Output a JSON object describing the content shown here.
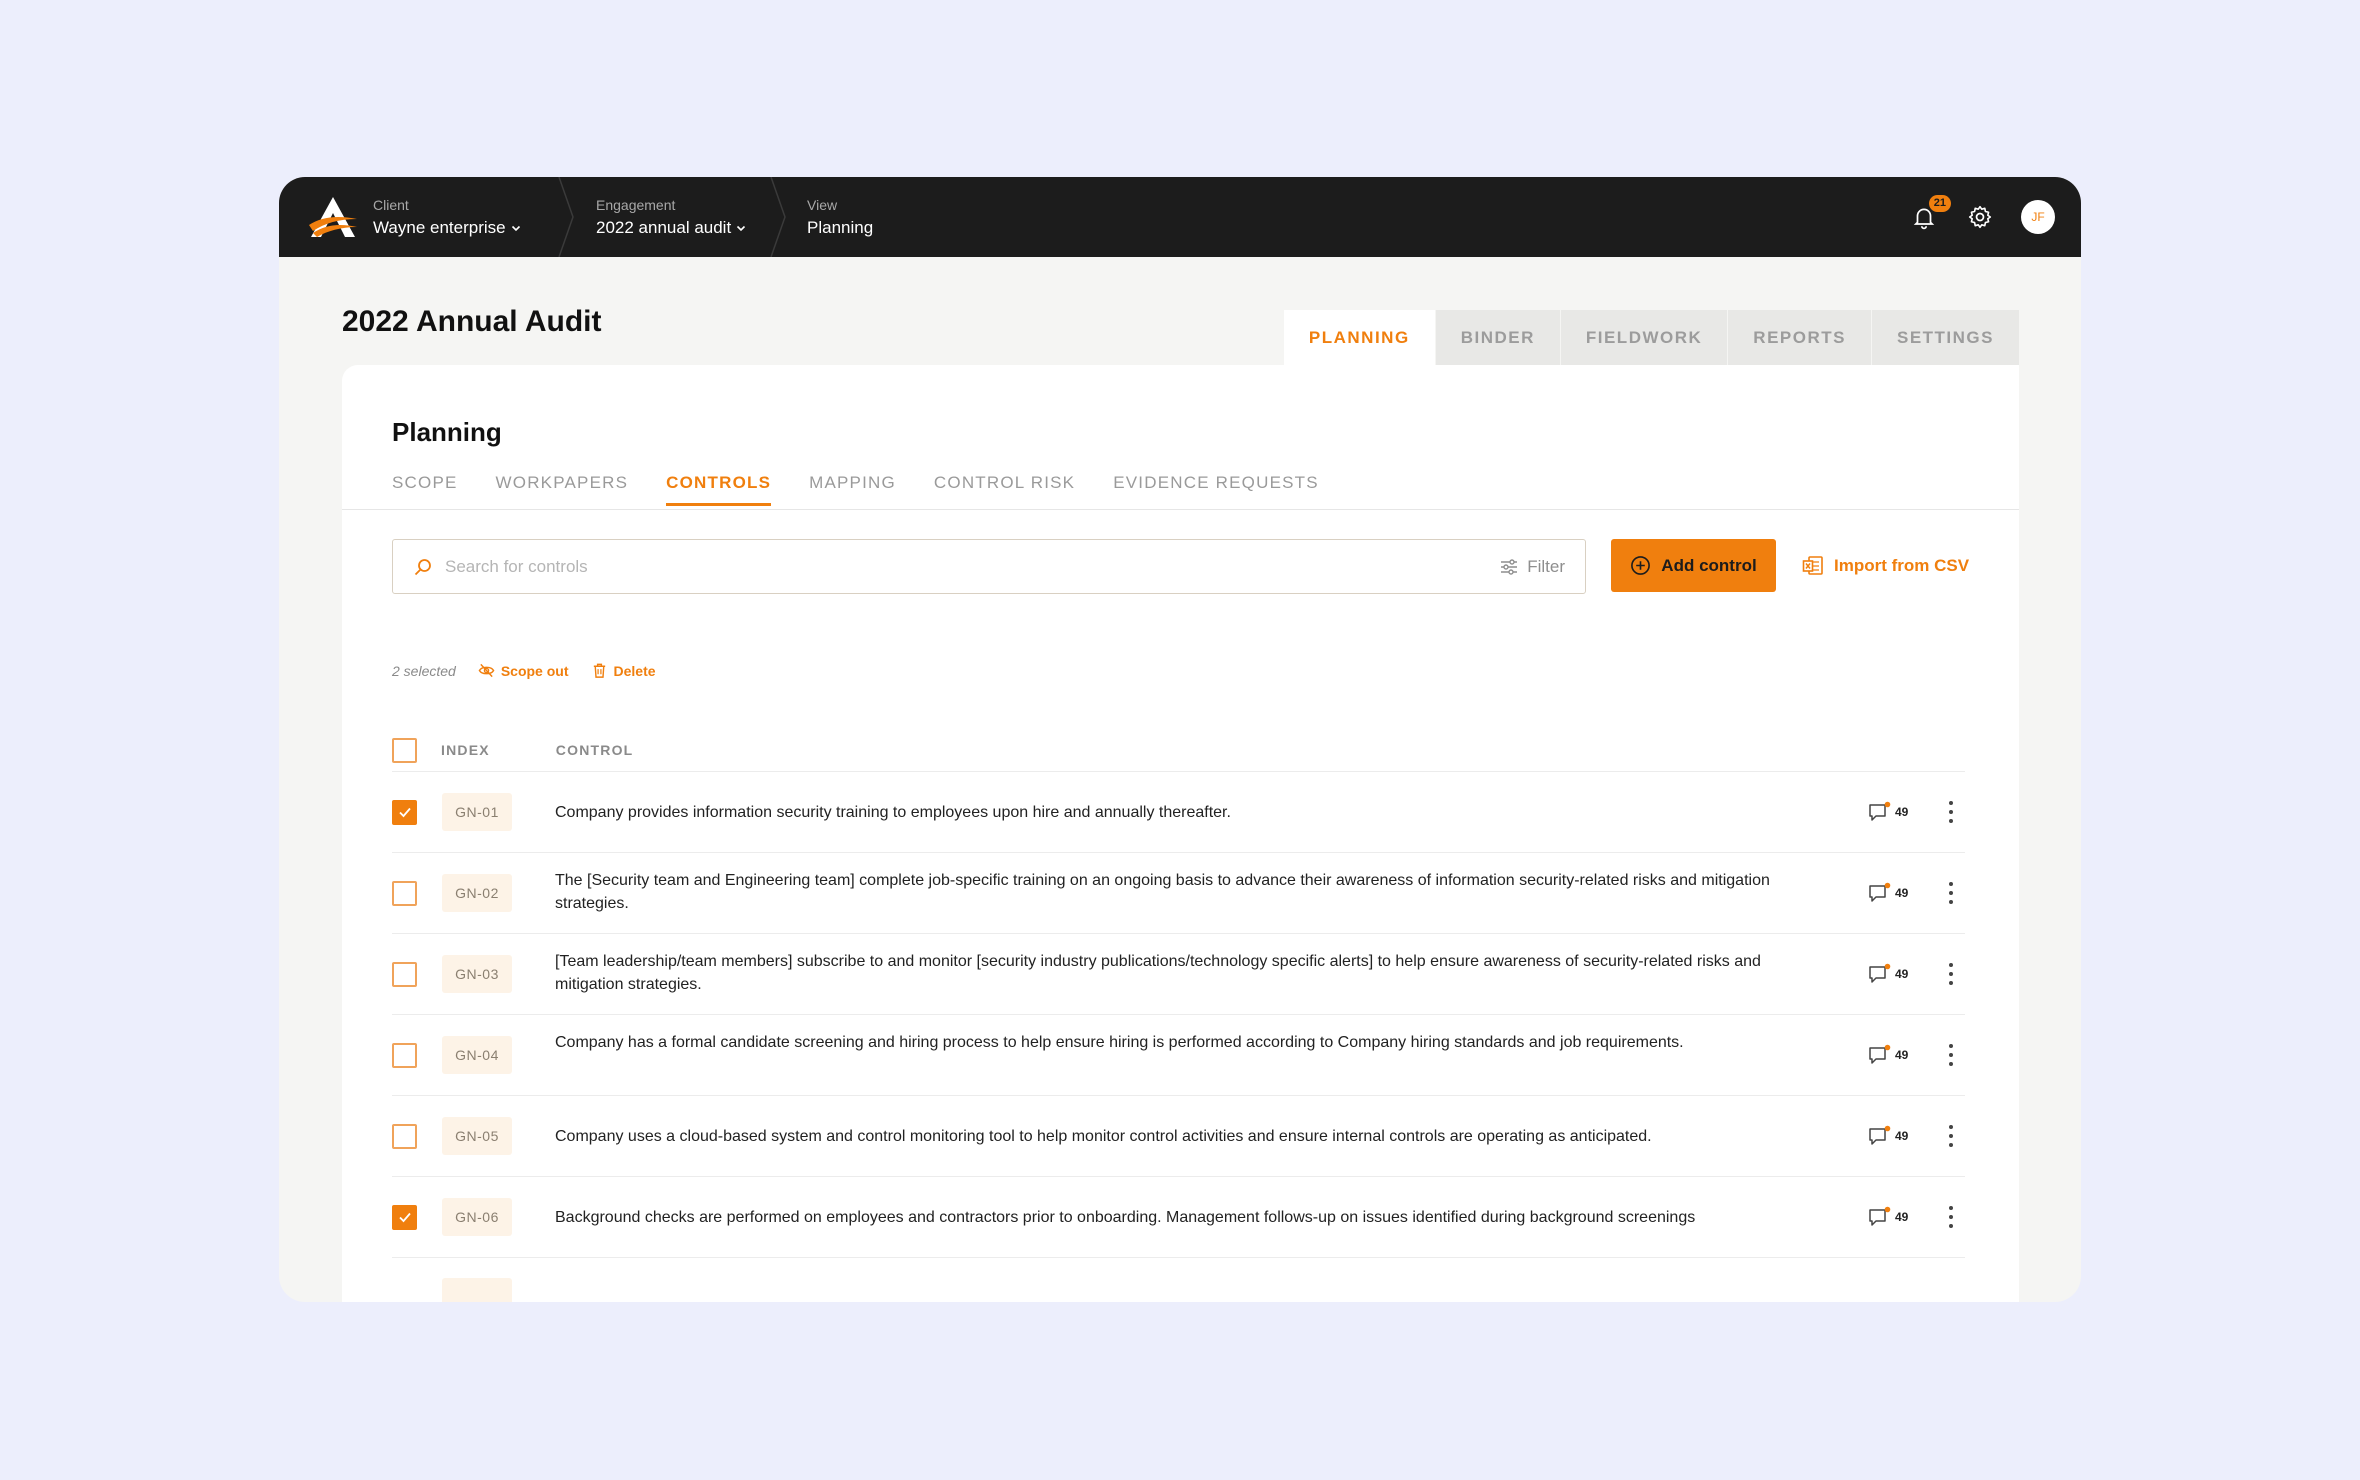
{
  "breadcrumbs": [
    {
      "label": "Client",
      "value": "Wayne enterprise"
    },
    {
      "label": "Engagement",
      "value": "2022 annual audit"
    },
    {
      "label": "View",
      "value": "Planning"
    }
  ],
  "topbar": {
    "notification_count": "21",
    "avatar_initials": "JF"
  },
  "page_title": "2022 Annual Audit",
  "main_tabs": [
    "PLANNING",
    "BINDER",
    "FIELDWORK",
    "REPORTS",
    "SETTINGS"
  ],
  "section_title": "Planning",
  "sub_tabs": [
    "SCOPE",
    "WORKPAPERS",
    "CONTROLS",
    "MAPPING",
    "CONTROL RISK",
    "EVIDENCE REQUESTS"
  ],
  "search": {
    "placeholder": "Search for controls",
    "filter_label": "Filter"
  },
  "actions": {
    "add_control": "Add control",
    "import_csv": "Import from CSV"
  },
  "selection": {
    "count_label": "2 selected",
    "scope_out": "Scope out",
    "delete": "Delete"
  },
  "table": {
    "headers": {
      "index": "INDEX",
      "control": "CONTROL"
    },
    "rows": [
      {
        "index": "GN-01",
        "checked": true,
        "comments": "49",
        "control": "Company provides information security training to employees upon hire and annually thereafter."
      },
      {
        "index": "GN-02",
        "checked": false,
        "comments": "49",
        "control": "The [Security team and Engineering team] complete job-specific training on an ongoing basis to advance their awareness of information security-related risks and mitigation strategies."
      },
      {
        "index": "GN-03",
        "checked": false,
        "comments": "49",
        "control": "[Team leadership/team members] subscribe to and monitor [security industry publications/technology specific alerts] to help ensure awareness of security-related risks and mitigation strategies."
      },
      {
        "index": "GN-04",
        "checked": false,
        "comments": "49",
        "control": "Company has a formal candidate screening and hiring process to help ensure hiring is performed according to Company hiring standards and job requirements."
      },
      {
        "index": "GN-05",
        "checked": false,
        "comments": "49",
        "control": "Company uses a cloud-based system and control monitoring tool to help monitor control activities and ensure internal controls are operating as anticipated."
      },
      {
        "index": "GN-06",
        "checked": true,
        "comments": "49",
        "control": "Background checks are performed on employees and contractors prior to onboarding. Management follows-up on issues identified during background screenings"
      }
    ]
  },
  "colors": {
    "accent": "#f07f0e",
    "topbar": "#1c1c1c",
    "background": "#eceefc"
  }
}
